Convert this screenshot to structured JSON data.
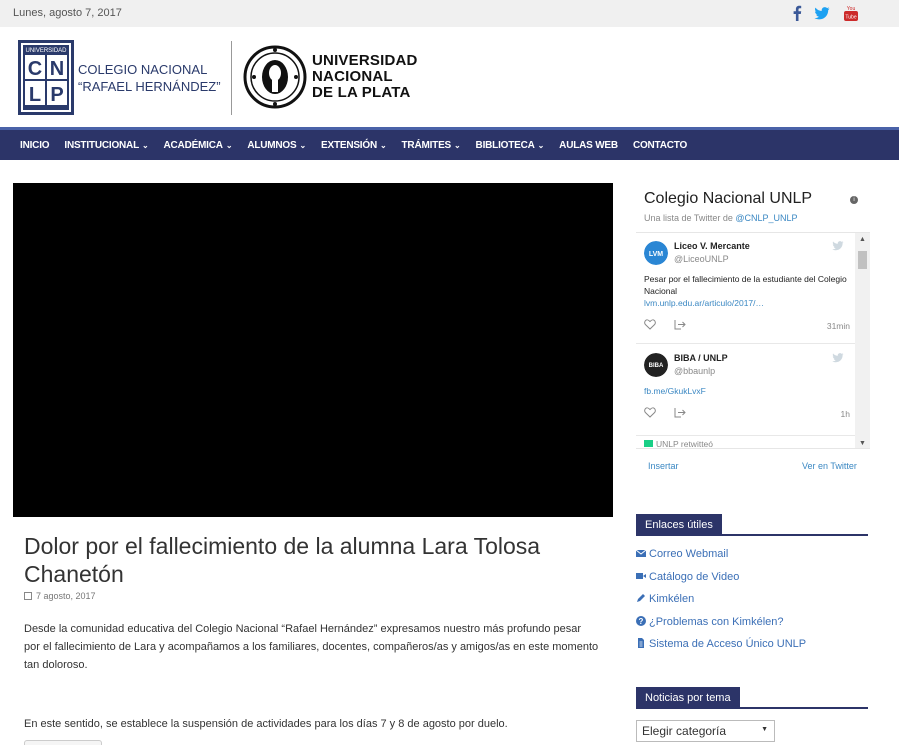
{
  "topbar": {
    "date": "Lunes, agosto 7, 2017",
    "social": [
      "facebook-icon",
      "twitter-icon",
      "youtube-icon"
    ]
  },
  "header": {
    "cnlp_logo_text": "UNIVERSIDAD CN LP",
    "school_line1": "COLEGIO NACIONAL",
    "school_line2": "“RAFAEL HERNÁNDEZ”",
    "unlp_line1": "UNIVERSIDAD",
    "unlp_line2": "NACIONAL",
    "unlp_line3": "DE LA PLATA"
  },
  "nav": {
    "items": [
      {
        "label": "INICIO",
        "dropdown": false
      },
      {
        "label": "INSTITUCIONAL",
        "dropdown": true
      },
      {
        "label": "ACADÉMICA",
        "dropdown": true
      },
      {
        "label": "ALUMNOS",
        "dropdown": true
      },
      {
        "label": "EXTENSIÓN",
        "dropdown": true
      },
      {
        "label": "TRÁMITES",
        "dropdown": true
      },
      {
        "label": "BIBLIOTECA",
        "dropdown": true
      },
      {
        "label": "AULAS WEB",
        "dropdown": false
      },
      {
        "label": "CONTACTO",
        "dropdown": false
      }
    ]
  },
  "article": {
    "title": "Dolor por el fallecimiento de la alumna Lara Tolosa Chanetón",
    "date": "7 agosto, 2017",
    "paragraph1": "Desde la comunidad educativa del Colegio Nacional “Rafael Hernández” expresamos nuestro más profundo pesar por el fallecimiento de Lara y acompañamos a los familiares, docentes, compañeros/as y amigos/as en este momento tan doloroso.",
    "paragraph2": "En este sentido, se establece la suspensión  de actividades para los días 7 y 8 de agosto por duelo."
  },
  "twitter": {
    "title": "Colegio Nacional UNLP",
    "subtitle_prefix": "Una lista de Twitter de ",
    "subtitle_handle": "@CNLP_UNLP",
    "tweets": [
      {
        "name": "Liceo V. Mercante",
        "handle": "@LiceoUNLP",
        "avatar_text": "LVM",
        "text": "Pesar por el fallecimiento de la estudiante del Colegio Nacional",
        "link": "lvm.unlp.edu.ar/articulo/2017/…",
        "ago": "31min"
      },
      {
        "name": "BIBA / UNLP",
        "handle": "@bbaunlp",
        "avatar_text": "BIBA",
        "text": "",
        "link": "fb.me/GkukLvxF",
        "ago": "1h"
      }
    ],
    "retweet_text": "UNLP retwitteó",
    "embed_label": "Insertar",
    "view_label": "Ver en Twitter"
  },
  "useful_links": {
    "heading": "Enlaces útiles",
    "items": [
      {
        "label": "Correo Webmail",
        "icon": "envelope-icon"
      },
      {
        "label": "Catálogo de Video",
        "icon": "video-camera-icon"
      },
      {
        "label": "Kimkélen",
        "icon": "pencil-icon"
      },
      {
        "label": "¿Problemas con Kimkélen?",
        "icon": "question-circle-icon"
      },
      {
        "label": "Sistema de Acceso Único UNLP",
        "icon": "document-icon"
      }
    ]
  },
  "news_by_topic": {
    "heading": "Noticias por tema",
    "select_value": "Elegir categoría"
  },
  "colors": {
    "nav_bg": "#2c3468",
    "nav_accent": "#4a62a8",
    "link_blue": "#3b6fb6",
    "twitter_blue": "#3b88c3",
    "facebook_blue": "#3b5998",
    "twitter_icon_blue": "#1da1f2",
    "youtube_red": "#cc2a2a"
  }
}
